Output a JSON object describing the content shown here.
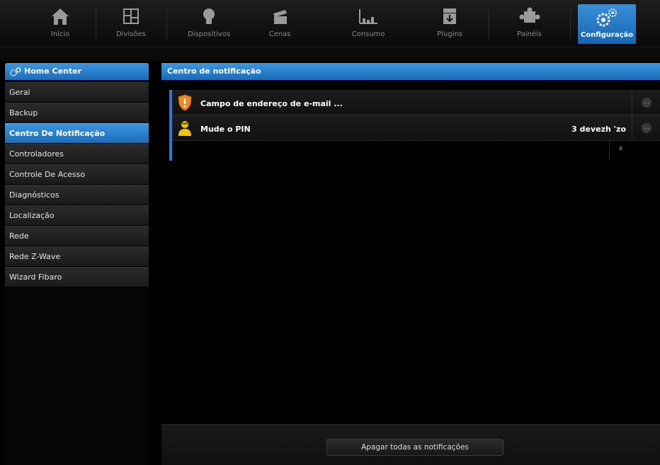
{
  "nav": {
    "items": [
      {
        "label": "Início",
        "icon": "home-icon"
      },
      {
        "label": "Divisões",
        "icon": "rooms-icon"
      },
      {
        "label": "Dispositivos",
        "icon": "lightbulb-icon"
      },
      {
        "label": "Cenas",
        "icon": "clapperboard-icon"
      },
      {
        "label": "Consumo",
        "icon": "bar-chart-icon"
      },
      {
        "label": "Plugins",
        "icon": "plugin-box-icon"
      },
      {
        "label": "Painéis",
        "icon": "puzzle-icon"
      },
      {
        "label": "Configuração",
        "icon": "gears-icon"
      }
    ],
    "active_index": 7
  },
  "sidebar": {
    "title": "Home Center",
    "items": [
      {
        "label": "Geral"
      },
      {
        "label": "Backup"
      },
      {
        "label": "Centro De Notificação"
      },
      {
        "label": "Controladores"
      },
      {
        "label": "Controle De Acesso"
      },
      {
        "label": "Diagnósticos"
      },
      {
        "label": "Localização"
      },
      {
        "label": "Rede"
      },
      {
        "label": "Rede Z-Wave"
      },
      {
        "label": "Wizard Fibaro"
      }
    ],
    "active_index": 2
  },
  "main": {
    "title": "Centro de notificação",
    "notifications": [
      {
        "title": "Campo de endereço de e-mail ...",
        "time": "",
        "icon": "warning-shield-icon"
      },
      {
        "title": "Mude o PIN",
        "time": "3 devezh 'zo",
        "icon": "user-icon"
      }
    ],
    "more_label": "...",
    "close_label": "x",
    "clear_all_label": "Apagar todas as notificações"
  },
  "colors": {
    "accent_blue": "#2a7cc9",
    "header_blue": "#1a6bb8",
    "background": "#000000",
    "warning_orange": "#f08a1c",
    "user_yellow": "#f2c511"
  }
}
